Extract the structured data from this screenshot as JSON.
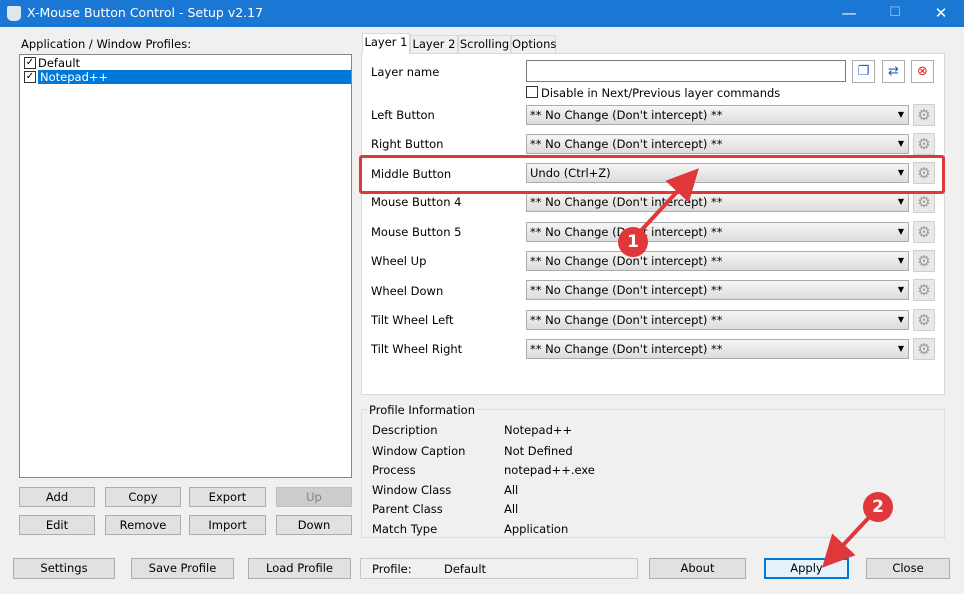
{
  "window": {
    "title": "X-Mouse Button Control - Setup v2.17",
    "minimize": "—",
    "maximize": "☐",
    "close": "✕"
  },
  "profiles": {
    "heading": "Application / Window Profiles:",
    "items": [
      {
        "label": "Default",
        "checked": "✓"
      },
      {
        "label": "Notepad++",
        "checked": "✓"
      }
    ],
    "buttons": {
      "add": "Add",
      "copy": "Copy",
      "export": "Export",
      "up": "Up",
      "edit": "Edit",
      "remove": "Remove",
      "import": "Import",
      "down": "Down"
    }
  },
  "tabs": [
    "Layer 1",
    "Layer 2",
    "Scrolling",
    "Options"
  ],
  "layer": {
    "name_label": "Layer name",
    "name_value": "",
    "disable_label": "Disable in Next/Previous layer commands",
    "rows": [
      {
        "label": "Left Button",
        "value": "** No Change (Don't intercept) **"
      },
      {
        "label": "Right Button",
        "value": "** No Change (Don't intercept) **"
      },
      {
        "label": "Middle Button",
        "value": "Undo (Ctrl+Z)"
      },
      {
        "label": "Mouse Button 4",
        "value": "** No Change (Don't intercept) **"
      },
      {
        "label": "Mouse Button 5",
        "value": "** No Change (Don't intercept) **"
      },
      {
        "label": "Wheel Up",
        "value": "** No Change (Don't intercept) **"
      },
      {
        "label": "Wheel Down",
        "value": "** No Change (Don't intercept) **"
      },
      {
        "label": "Tilt Wheel Left",
        "value": "** No Change (Don't intercept) **"
      },
      {
        "label": "Tilt Wheel Right",
        "value": "** No Change (Don't intercept) **"
      }
    ]
  },
  "profile_info": {
    "title": "Profile Information",
    "rows": [
      {
        "label": "Description",
        "value": "Notepad++"
      },
      {
        "label": "Window Caption",
        "value": "Not Defined"
      },
      {
        "label": "Process",
        "value": "notepad++.exe"
      },
      {
        "label": "Window Class",
        "value": "All"
      },
      {
        "label": "Parent Class",
        "value": "All"
      },
      {
        "label": "Match Type",
        "value": "Application"
      }
    ]
  },
  "bottom": {
    "settings": "Settings",
    "save_profile": "Save Profile",
    "load_profile": "Load Profile",
    "profile_label": "Profile:",
    "profile_value": "Default",
    "about": "About",
    "apply": "Apply",
    "close": "Close"
  },
  "annotations": {
    "marker1": "1",
    "marker2": "2",
    "accent": "#e0373a"
  }
}
